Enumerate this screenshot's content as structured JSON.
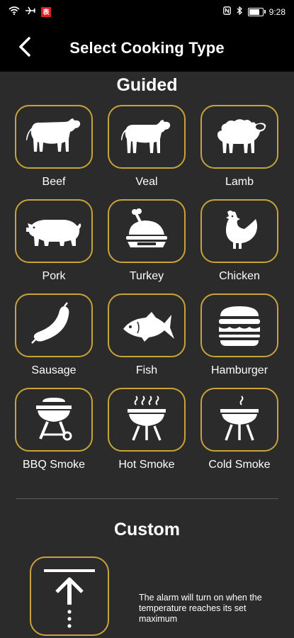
{
  "status": {
    "time": "9:28",
    "badge": "表"
  },
  "header": {
    "title": "Select Cooking Type"
  },
  "guided": {
    "title": "Guided",
    "items": [
      {
        "label": "Beef",
        "icon": "cow-icon"
      },
      {
        "label": "Veal",
        "icon": "calf-icon"
      },
      {
        "label": "Lamb",
        "icon": "sheep-icon"
      },
      {
        "label": "Pork",
        "icon": "pig-icon"
      },
      {
        "label": "Turkey",
        "icon": "roast-turkey-icon"
      },
      {
        "label": "Chicken",
        "icon": "chicken-icon"
      },
      {
        "label": "Sausage",
        "icon": "sausage-icon"
      },
      {
        "label": "Fish",
        "icon": "fish-icon"
      },
      {
        "label": "Hamburger",
        "icon": "hamburger-icon"
      },
      {
        "label": "BBQ Smoke",
        "icon": "bbq-grill-icon"
      },
      {
        "label": "Hot Smoke",
        "icon": "hot-smoke-grill-icon"
      },
      {
        "label": "Cold Smoke",
        "icon": "cold-smoke-grill-icon"
      }
    ]
  },
  "custom": {
    "title": "Custom",
    "icon": "max-temperature-arrow-icon",
    "note": "The alarm will turn on when the temperature reaches its set maximum"
  },
  "colors": {
    "accent": "#c8a23a",
    "background": "#2b2b2b",
    "bar": "#000000"
  }
}
